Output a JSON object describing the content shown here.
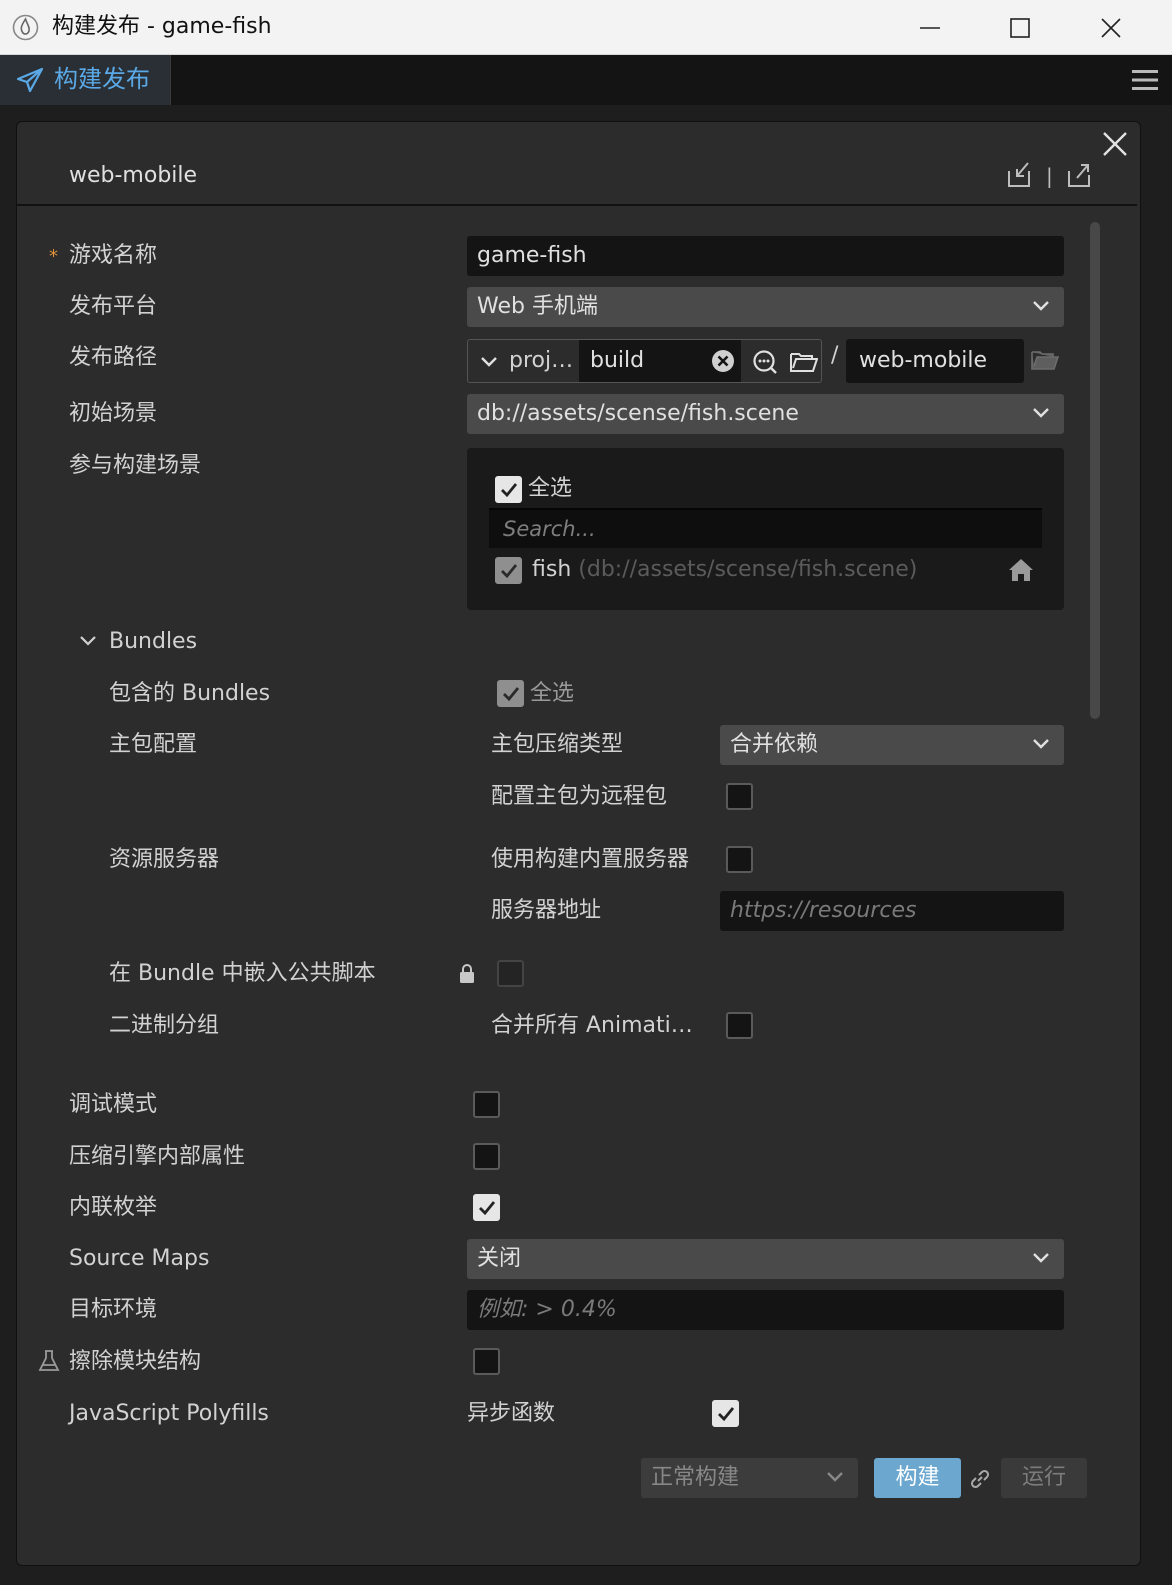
{
  "window": {
    "title": "构建发布 - game-fish"
  },
  "tab": {
    "label": "构建发布"
  },
  "dialog": {
    "platform": "web-mobile"
  },
  "form": {
    "game_name": {
      "label": "游戏名称",
      "value": "game-fish",
      "required_mark": "*"
    },
    "platform": {
      "label": "发布平台",
      "value": "Web 手机端"
    },
    "build_path": {
      "label": "发布路径",
      "prefix": "proj…",
      "folder": "build",
      "separator": "/",
      "subfolder": "web-mobile"
    },
    "start_scene": {
      "label": "初始场景",
      "value": "db://assets/scense/fish.scene"
    },
    "scenes": {
      "label": "参与构建场景",
      "select_all": "全选",
      "search_placeholder": "Search...",
      "items": [
        {
          "name": "fish",
          "path": "(db://assets/scense/fish.scene)",
          "checked": true
        }
      ]
    },
    "bundles": {
      "section": "Bundles",
      "included": {
        "label": "包含的 Bundles",
        "select_all": "全选"
      },
      "main_config": {
        "label": "主包配置",
        "compress_label": "主包压缩类型",
        "compress_value": "合并依赖",
        "remote_label": "配置主包为远程包"
      },
      "resource_server": {
        "label": "资源服务器",
        "builtin_label": "使用构建内置服务器",
        "address_label": "服务器地址",
        "address_placeholder": "https://resources"
      },
      "embed_scripts": {
        "label": "在 Bundle 中嵌入公共脚本"
      },
      "binary_group": {
        "label": "二进制分组",
        "merge_label": "合并所有 Animati…"
      }
    },
    "debug": {
      "label": "调试模式",
      "checked": false
    },
    "mangle": {
      "label": "压缩引擎内部属性",
      "checked": false
    },
    "inline_enum": {
      "label": "内联枚举",
      "checked": true
    },
    "source_maps": {
      "label": "Source Maps",
      "value": "关闭"
    },
    "target_env": {
      "label": "目标环境",
      "placeholder": "例如: > 0.4%"
    },
    "erase_module": {
      "label": "擦除模块结构",
      "checked": false
    },
    "polyfills": {
      "label": "JavaScript Polyfills",
      "async_label": "异步函数",
      "checked": true
    }
  },
  "footer": {
    "build_mode": "正常构建",
    "build_button": "构建",
    "run_button": "运行"
  },
  "colors": {
    "accent": "#5aa9e6",
    "build_button": "#6ba7cf",
    "required": "#e0913a"
  }
}
